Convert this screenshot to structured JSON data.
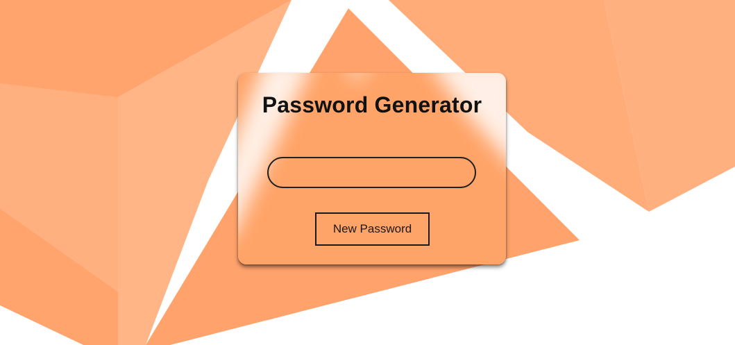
{
  "app": {
    "title": "Password Generator"
  },
  "password_field": {
    "value": "",
    "placeholder": ""
  },
  "actions": {
    "new_password_label": "New Password"
  },
  "colors": {
    "accent_orange": "#ffa26b",
    "light_orange": "#ffb07e",
    "background": "#ffffff",
    "text": "#111111"
  }
}
